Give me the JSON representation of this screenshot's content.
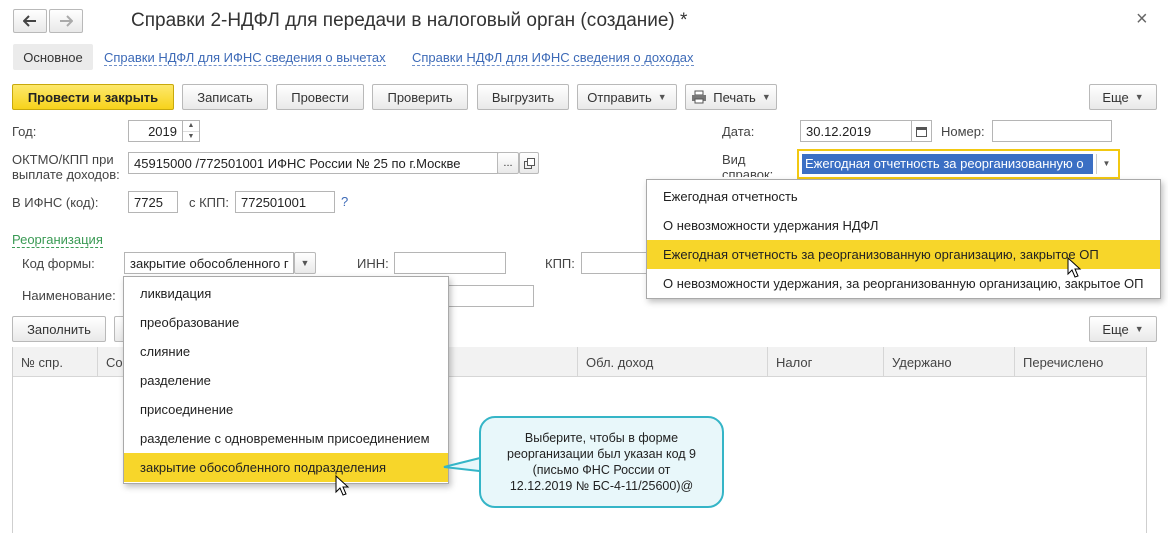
{
  "nav": {
    "back_icon": "arrow-left-icon",
    "forward_icon": "arrow-right-icon"
  },
  "window": {
    "title": "Справки 2-НДФЛ для передачи в налоговый орган (создание) *",
    "close_glyph": "×"
  },
  "tabs": [
    {
      "label": "Основное"
    },
    {
      "label": "Справки НДФЛ для ИФНС сведения о вычетах"
    },
    {
      "label": "Справки НДФЛ для ИФНС сведения о доходах"
    }
  ],
  "toolbar": {
    "post_close": "Провести и закрыть",
    "save": "Записать",
    "post": "Провести",
    "check": "Проверить",
    "export": "Выгрузить",
    "send": "Отправить",
    "print": "Печать",
    "more": "Еще"
  },
  "form": {
    "year_label": "Год:",
    "year_value": "2019",
    "oktmo_label_1": "ОКТМО/КПП при",
    "oktmo_label_2": "выплате доходов:",
    "oktmo_value": "45915000   /772501001 ИФНС России № 25 по г.Москве",
    "oktmo_more": "...",
    "ifns_label": "В ИФНС (код):",
    "ifns_value": "7725",
    "kpp_label": "с КПП:",
    "kpp_value": "772501001",
    "help": "?",
    "date_label": "Дата:",
    "date_value": "30.12.2019",
    "number_label": "Номер:",
    "number_value": "",
    "kind_label_1": "Вид",
    "kind_label_2": "справок:",
    "kind_value": "Ежегодная отчетность за реорганизованную о"
  },
  "reorg": {
    "section_label": "Реорганизация",
    "form_code_label": "Код формы:",
    "form_code_value": "закрытие обособленного г",
    "inn_label": "ИНН:",
    "inn_value": "",
    "kpp_label": "КПП:",
    "kpp_value": "",
    "name_label": "Наименование:",
    "name_value": ""
  },
  "table": {
    "fill_button": "Заполнить",
    "more_button": "Еще",
    "columns": [
      "№ спр.",
      "Со",
      "Обл. доход",
      "Налог",
      "Удержано",
      "Перечислено"
    ]
  },
  "form_code_dropdown": {
    "items": [
      "ликвидация",
      "преобразование",
      "слияние",
      "разделение",
      "присоединение",
      "разделение с одновременным присоединением",
      "закрытие обособленного подразделения"
    ],
    "selected_index": 6
  },
  "kind_dropdown": {
    "items": [
      "Ежегодная отчетность",
      "О невозможности удержания НДФЛ",
      "Ежегодная отчетность за реорганизованную организацию, закрытое ОП",
      "О невозможности удержания, за реорганизованную организацию, закрытое ОП"
    ],
    "selected_index": 2
  },
  "callout": {
    "line1": "Выберите, чтобы в форме",
    "line2": "реорганизации был указан код 9",
    "line3": "(письмо ФНС России от",
    "line4": "12.12.2019 № БС-4-11/25600)@"
  },
  "colors": {
    "accent_yellow": "#f7d62a",
    "link_blue": "#3d6ab7",
    "callout_border": "#35b5c7",
    "callout_fill": "#e8f7fa"
  }
}
